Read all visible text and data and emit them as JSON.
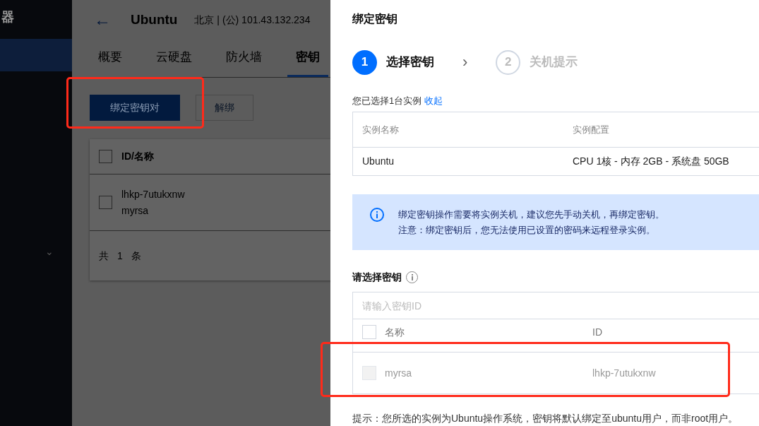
{
  "sidebar": {
    "title": "器",
    "items": [
      {
        "selected": true
      }
    ],
    "expander": "⌄"
  },
  "header": {
    "back": "←",
    "title": "Ubuntu",
    "subtitle": "北京 | (公) 101.43.132.234"
  },
  "tabs": [
    {
      "label": "概要",
      "selected": false
    },
    {
      "label": "云硬盘",
      "selected": false
    },
    {
      "label": "防火墙",
      "selected": false
    },
    {
      "label": "密钥",
      "selected": true
    }
  ],
  "actions": [
    {
      "label": "绑定密钥对",
      "kind": "primary"
    },
    {
      "label": "解绑",
      "kind": "secondary"
    }
  ],
  "key_table": {
    "select_all": false,
    "columns": [
      "ID/名称"
    ],
    "rows": [
      {
        "id": "lhkp-7utukxnw",
        "name": "myrsa",
        "checked": false
      }
    ],
    "footer": "共 1 条"
  },
  "drawer": {
    "title": "绑定密钥",
    "steps": [
      {
        "number": "1",
        "label": "选择密钥",
        "selected": true
      },
      {
        "number": "2",
        "label": "关机提示",
        "selected": false
      }
    ],
    "step_separator": "›",
    "selection_note": "您已选择1台实例",
    "collapse_link": "收起",
    "instance_table": {
      "columns": [
        "实例名称",
        "实例配置"
      ],
      "rows": [
        [
          "Ubuntu",
          "CPU 1核 - 内存 2GB - 系统盘 50GB"
        ]
      ]
    },
    "notice": [
      "绑定密钥操作需要将实例关机，建议您先手动关机，再绑定密钥。",
      "注意：绑定密钥后，您无法使用已设置的密码来远程登录实例。"
    ],
    "key_label": "请选择密钥",
    "search": {
      "placeholder": "请输入密钥ID"
    },
    "keys": {
      "select_all": false,
      "columns": [
        "名称",
        "ID"
      ],
      "rows": [
        {
          "name": "myrsa",
          "id": "lhkp-7utukxnw",
          "checked": false,
          "disabled": true
        }
      ]
    },
    "hint": "提示：您所选的实例为Ubuntu操作系统，密钥将默认绑定至ubuntu用户，而非root用户。"
  }
}
